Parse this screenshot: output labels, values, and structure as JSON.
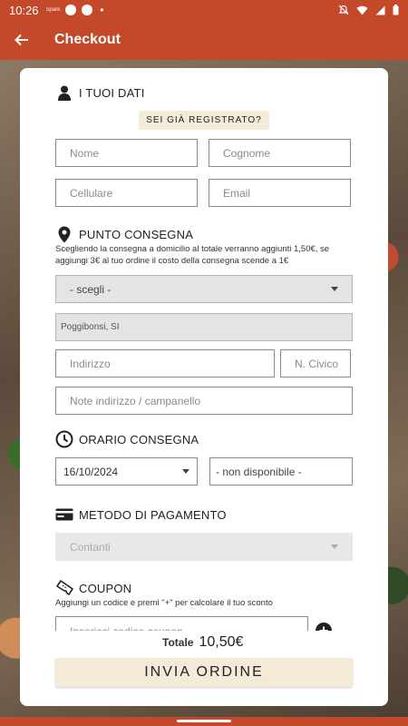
{
  "status_bar": {
    "time": "10:26",
    "mini_label": "Spark"
  },
  "app_bar": {
    "title": "Checkout"
  },
  "user_section": {
    "title": "I TUOI DATI",
    "registered_button": "SEI GIÀ REGISTRATO?",
    "first_name_placeholder": "Nome",
    "last_name_placeholder": "Cognome",
    "phone_placeholder": "Cellulare",
    "email_placeholder": "Email"
  },
  "delivery_section": {
    "title": "PUNTO CONSEGNA",
    "helper": "Scegliendo la consegna a domicilio al totale verranno aggiunti 1,50€, se aggiungi 3€ al tuo ordine il costo della consegna scende a 1€",
    "select_value": "- scegli -",
    "city_value": "Poggibonsi, SI",
    "address_placeholder": "Indirizzo",
    "civic_placeholder": "N. Civico",
    "notes_placeholder": "Note indirizzo / campanello"
  },
  "time_section": {
    "title": "ORARIO CONSEGNA",
    "date_value": "16/10/2024",
    "time_value": "- non disponibile -"
  },
  "payment_section": {
    "title": "METODO DI PAGAMENTO",
    "method_value": "Contanti"
  },
  "coupon_section": {
    "title": "COUPON",
    "helper": "Aggiungi un codice e premi \"+\" per calcolare il tuo sconto",
    "code_placeholder": "Inserisci codice coupon"
  },
  "footer": {
    "total_label": "Totale",
    "total_value": "10,50€",
    "send_button": "INVIA ORDINE"
  },
  "colors": {
    "brand": "#c4492b",
    "button_bg": "#f3ead8"
  }
}
